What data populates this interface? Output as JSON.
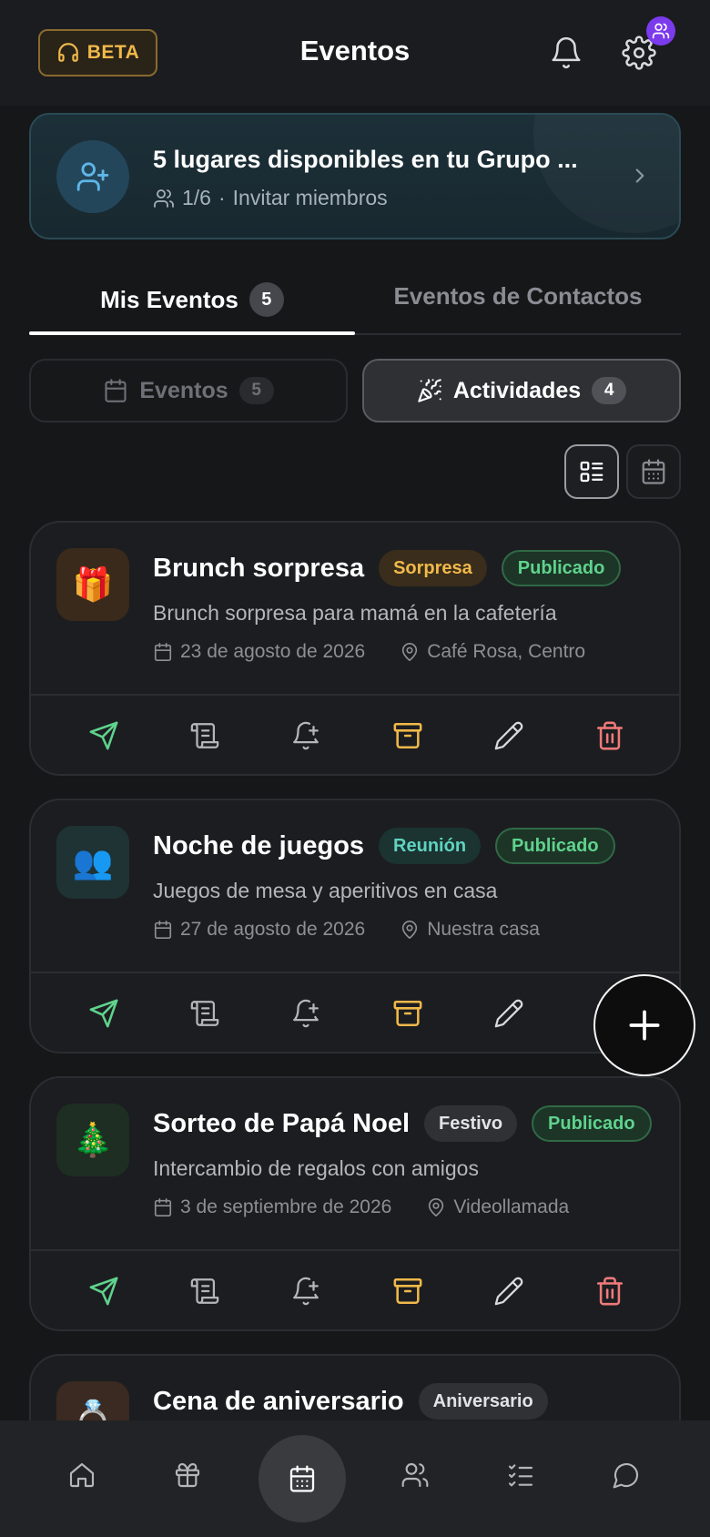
{
  "header": {
    "beta_label": "BETA",
    "title": "Eventos",
    "icons": {
      "support": "headset-icon",
      "notifications": "bell-icon",
      "settings": "gear-icon",
      "badge": "users-icon"
    }
  },
  "group_banner": {
    "title": "5 lugares disponibles en tu Grupo ...",
    "members": "1/6",
    "separator": "·",
    "invite": "Invitar miembros"
  },
  "tabs": [
    {
      "label": "Mis Eventos",
      "count": "5",
      "active": true
    },
    {
      "label": "Eventos de Contactos",
      "active": false
    }
  ],
  "segments": [
    {
      "label": "Eventos",
      "count": "5",
      "active": false
    },
    {
      "label": "Actividades",
      "count": "4",
      "active": true
    }
  ],
  "events": [
    {
      "emoji": "🎁",
      "title": "Brunch sorpresa",
      "category": "Sorpresa",
      "status": "Publicado",
      "description": "Brunch sorpresa para mamá en la cafetería",
      "date": "23 de agosto de 2026",
      "location": "Café Rosa, Centro"
    },
    {
      "emoji": "👥",
      "title": "Noche de juegos",
      "category": "Reunión",
      "status": "Publicado",
      "description": "Juegos de mesa y aperitivos en casa",
      "date": "27 de agosto de 2026",
      "location": "Nuestra casa"
    },
    {
      "emoji": "🎄",
      "title": "Sorteo de Papá Noel",
      "category": "Festivo",
      "status": "Publicado",
      "description": "Intercambio de regalos con amigos",
      "date": "3 de septiembre de 2026",
      "location": "Videollamada"
    },
    {
      "emoji": "💍",
      "title": "Cena de aniversario",
      "category": "Aniversario"
    }
  ],
  "colors": {
    "accent_beta": "#f0b94a",
    "published": "#5fd38d",
    "surprise": "#f0b94a",
    "meeting": "#5fd3c0",
    "send": "#5fd38d",
    "archive": "#f0b94a",
    "delete": "#f07a7a"
  },
  "bottom_nav": [
    "home-icon",
    "gift-icon",
    "calendar-icon",
    "users-icon",
    "checklist-icon",
    "chat-icon"
  ]
}
